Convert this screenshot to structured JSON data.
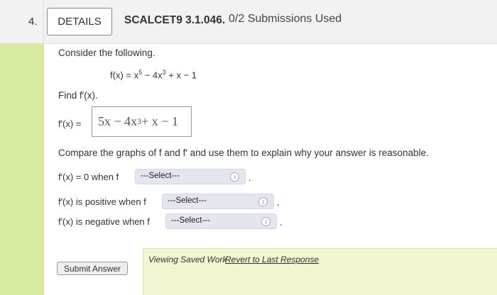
{
  "header": {
    "question_number": "4.",
    "details_label": "DETAILS",
    "assignment_id": "SCALCET9 3.1.046.",
    "submissions": "0/2 Submissions Used"
  },
  "question": {
    "intro": "Consider the following.",
    "function_def": {
      "lhs": "f(x) = x",
      "exp1": "5",
      "mid": " − 4x",
      "exp2": "3",
      "tail": " + x − 1"
    },
    "find_prompt": "Find f′(x).",
    "answer_label": "f′(x) =",
    "answer_value": {
      "part1": "5x − 4x",
      "exp": "3",
      "part2": " + x − 1"
    },
    "compare_prompt": "Compare the graphs of f and f′ and use them to explain why your answer is reasonable.",
    "statements": [
      {
        "prefix": "f′(x) = 0 when f",
        "select": "---Select---",
        "suffix": "."
      },
      {
        "prefix": "f′(x) is positive when f",
        "select": "---Select---",
        "suffix": "."
      },
      {
        "prefix": "f′(x) is negative when f",
        "select": "---Select---",
        "suffix": "."
      }
    ]
  },
  "footer": {
    "submit_label": "Submit Answer",
    "viewing_saved": "Viewing Saved Work",
    "revert_link": "Revert to Last Response"
  },
  "colors": {
    "left_stripe": "#d7e9a0",
    "select_bg": "#e3e6ef",
    "saved_panel": "#f3f5d0"
  }
}
